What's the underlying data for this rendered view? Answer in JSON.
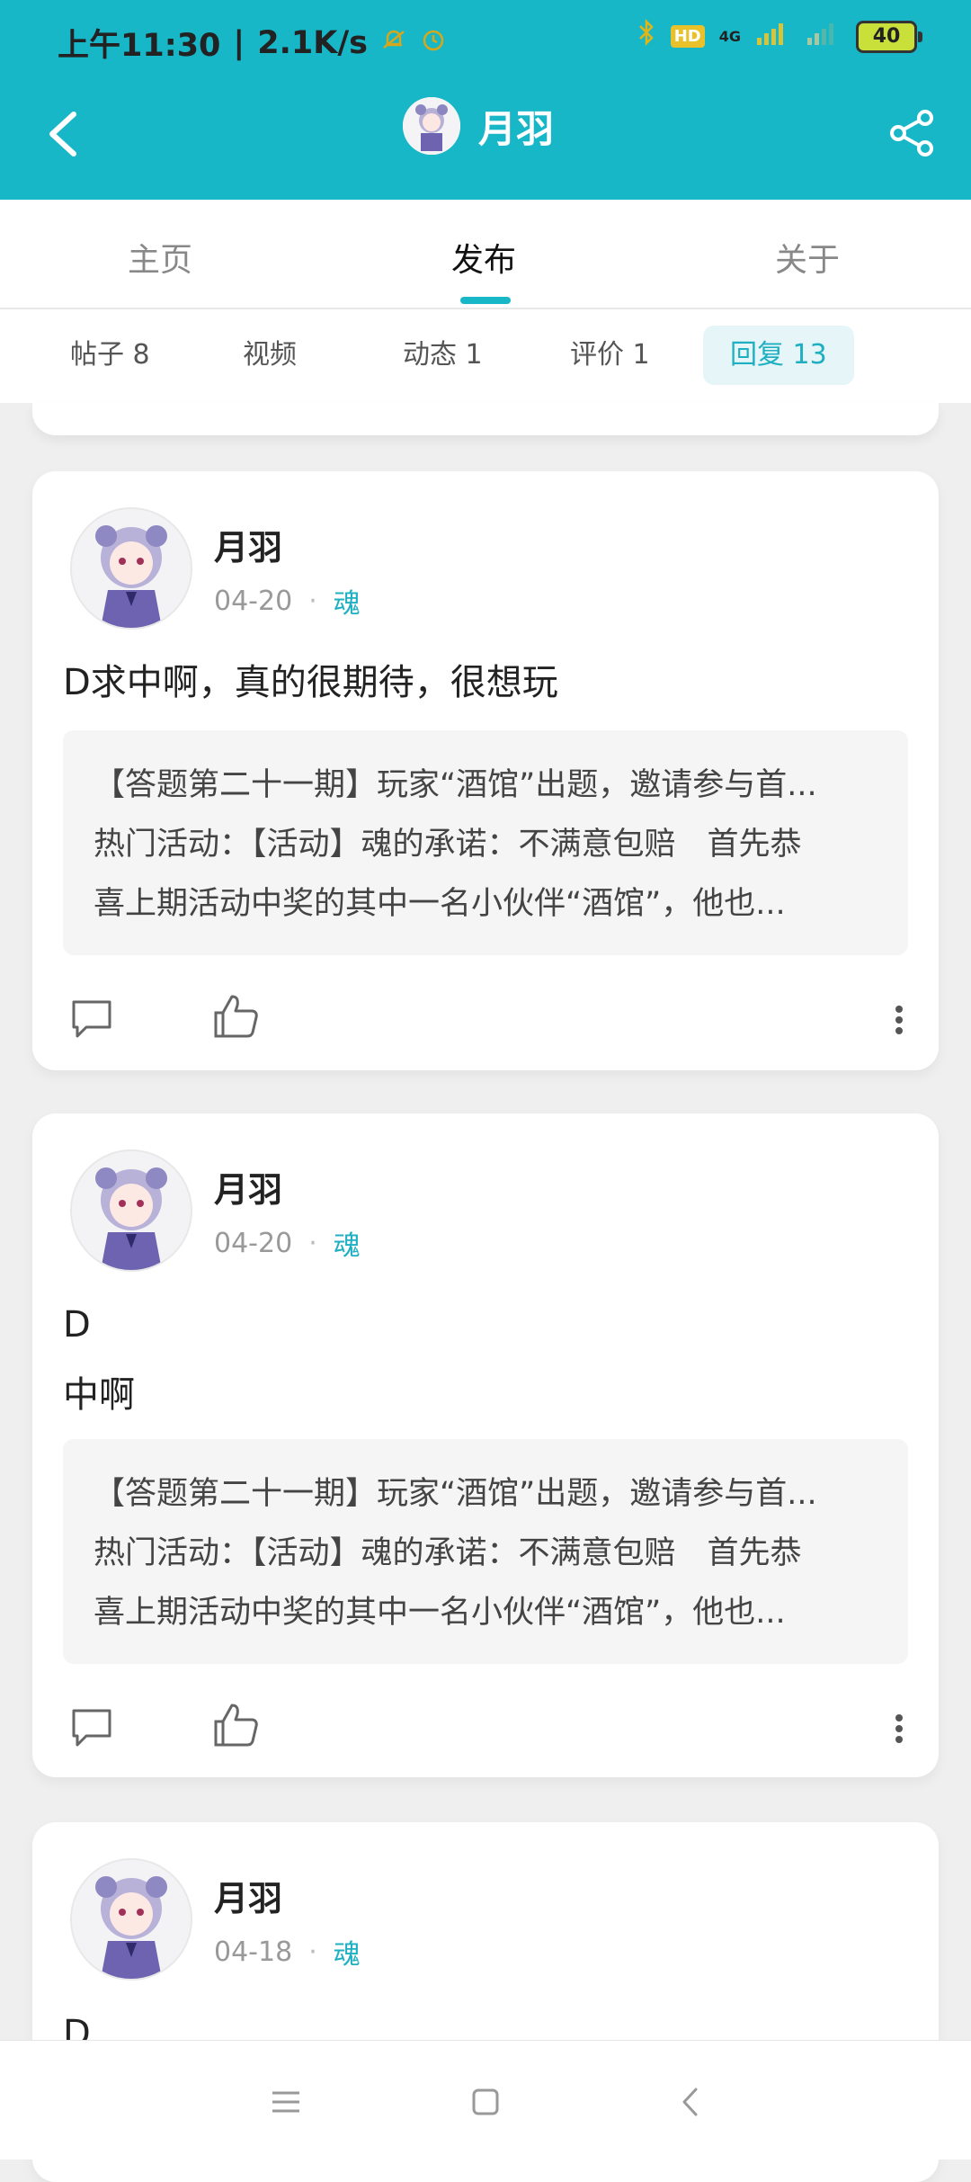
{
  "status_bar": {
    "time": "上午11:30",
    "speed": "2.1K/s",
    "network": "4G",
    "hd": "HD",
    "battery": "40"
  },
  "app_bar": {
    "title": "月羽"
  },
  "tabs": [
    {
      "label": "主页",
      "active": false
    },
    {
      "label": "发布",
      "active": true
    },
    {
      "label": "关于",
      "active": false
    }
  ],
  "subtabs": [
    {
      "label": "帖子 8"
    },
    {
      "label": "视频"
    },
    {
      "label": "动态 1"
    },
    {
      "label": "评价 1"
    },
    {
      "label": "回复 13",
      "active": true
    }
  ],
  "posts": [
    {
      "author": "月羽",
      "date": "04-20",
      "tag": "魂",
      "content": "D求中啊，真的很期待，很想玩",
      "quote": [
        "【答题第二十一期】玩家“酒馆”出题，邀请参与首...",
        "热门活动：【活动】魂的承诺：不满意包赔　首先恭",
        "喜上期活动中奖的其中一名小伙伴“酒馆”，他也..."
      ]
    },
    {
      "author": "月羽",
      "date": "04-20",
      "tag": "魂",
      "content": "D\n中啊",
      "quote": [
        "【答题第二十一期】玩家“酒馆”出题，邀请参与首...",
        "热门活动：【活动】魂的承诺：不满意包赔　首先恭",
        "喜上期活动中奖的其中一名小伙伴“酒馆”，他也..."
      ]
    },
    {
      "author": "月羽",
      "date": "04-18",
      "tag": "魂",
      "content": "D"
    }
  ],
  "colors": {
    "accent": "#18b7c8",
    "tag": "#1eb0c2"
  },
  "icons": {
    "back": "back-arrow-icon",
    "share": "share-icon",
    "comment": "comment-icon",
    "like": "thumbs-up-icon",
    "more": "more-vertical-icon"
  }
}
